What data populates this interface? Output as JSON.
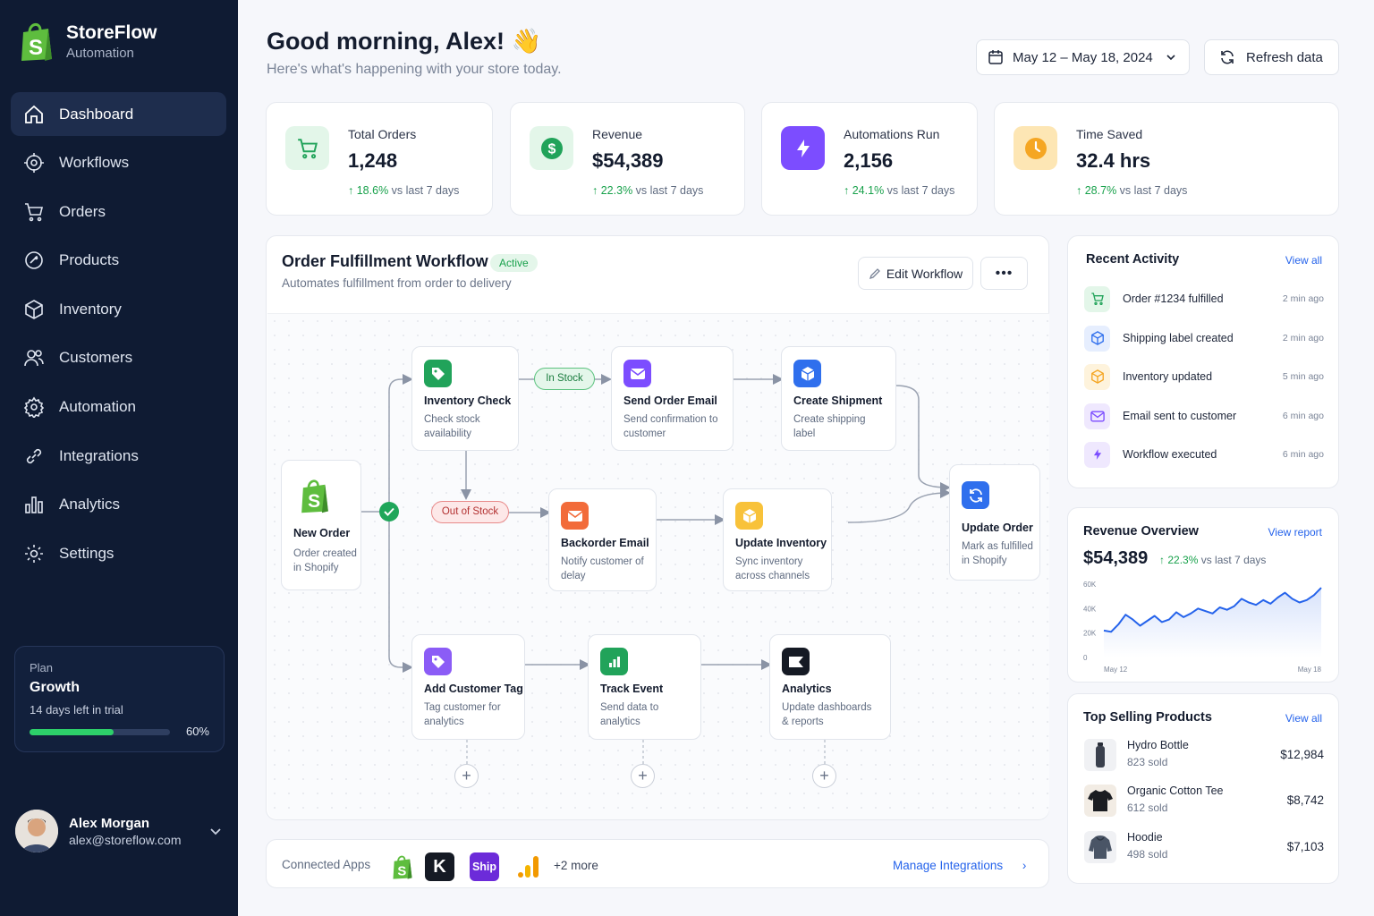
{
  "brand": {
    "name": "StoreFlow",
    "subtitle": "Automation"
  },
  "nav": [
    {
      "label": "Dashboard",
      "icon": "home-icon",
      "active": true
    },
    {
      "label": "Workflows",
      "icon": "workflow-icon"
    },
    {
      "label": "Orders",
      "icon": "cart-icon"
    },
    {
      "label": "Products",
      "icon": "tag-icon"
    },
    {
      "label": "Inventory",
      "icon": "box-icon"
    },
    {
      "label": "Customers",
      "icon": "users-icon"
    },
    {
      "label": "Automation",
      "icon": "gear-icon"
    },
    {
      "label": "Integrations",
      "icon": "link-icon"
    },
    {
      "label": "Analytics",
      "icon": "bar-chart-icon"
    },
    {
      "label": "Settings",
      "icon": "settings-icon"
    }
  ],
  "plan": {
    "label": "Plan",
    "name": "Growth",
    "trial": "14 days left in trial",
    "progress": 0.6,
    "progress_text": "60%"
  },
  "user": {
    "name": "Alex Morgan",
    "email": "alex@storeflow.com"
  },
  "header": {
    "greeting": "Good morning, Alex!",
    "greeting_emoji": "👋",
    "subtitle": "Here's what's happening with your store today.",
    "date_range": "May 12 – May 18, 2024",
    "refresh_label": "Refresh data"
  },
  "stats": [
    {
      "label": "Total Orders",
      "value": "1,248",
      "change": "18.6%",
      "period": "vs last 7 days",
      "icon": "cart-icon",
      "color": "#21a35a"
    },
    {
      "label": "Revenue",
      "value": "$54,389",
      "change": "22.3%",
      "period": "vs last 7 days",
      "icon": "dollar-icon",
      "color": "#21a35a"
    },
    {
      "label": "Automations Run",
      "value": "2,156",
      "change": "24.1%",
      "period": "vs last 7 days",
      "icon": "bolt-icon",
      "color": "#7c4dff"
    },
    {
      "label": "Time Saved",
      "value": "32.4 hrs",
      "change": "28.7%",
      "period": "vs last 7 days",
      "icon": "clock-icon",
      "color": "#f5a623"
    }
  ],
  "workflow": {
    "title": "Order Fulfillment Workflow",
    "status": "Active",
    "description": "Automates fulfillment from order to delivery",
    "edit_label": "Edit Workflow",
    "more_label": "•••",
    "nodes": {
      "new_order": {
        "title": "New Order",
        "desc": "Order created in Shopify"
      },
      "inventory_check": {
        "title": "Inventory Check",
        "desc": "Check stock availability"
      },
      "send_email": {
        "title": "Send Order Email",
        "desc": "Send confirmation to customer"
      },
      "create_shipment": {
        "title": "Create Shipment",
        "desc": "Create shipping label"
      },
      "backorder": {
        "title": "Backorder Email",
        "desc": "Notify customer of delay"
      },
      "update_inventory": {
        "title": "Update Inventory",
        "desc": "Sync inventory across channels"
      },
      "update_order": {
        "title": "Update Order",
        "desc": "Mark as fulfilled in Shopify"
      },
      "add_tag": {
        "title": "Add Customer Tag",
        "desc": "Tag customer for analytics"
      },
      "track_event": {
        "title": "Track Event",
        "desc": "Send data to analytics"
      },
      "analytics": {
        "title": "Analytics",
        "desc": "Update dashboards & reports"
      }
    },
    "in_stock_label": "In Stock",
    "out_of_stock_label": "Out of Stock",
    "add_step": "+"
  },
  "connected_apps": {
    "label": "Connected Apps",
    "apps": [
      "shopify-icon",
      "klaviyo-icon",
      "shipstation-icon",
      "analytics-icon"
    ],
    "ship_text": "Ship",
    "k_text": "K",
    "more": "+2 more",
    "manage_label": "Manage Integrations"
  },
  "recent_activity": {
    "title": "Recent Activity",
    "view_all": "View all",
    "items": [
      {
        "text": "Order #1234 fulfilled",
        "time": "2 min ago",
        "icon": "cart-icon",
        "color": "#21a35a"
      },
      {
        "text": "Shipping label created",
        "time": "2 min ago",
        "icon": "box-icon",
        "color": "#2f6fed"
      },
      {
        "text": "Inventory updated",
        "time": "5 min ago",
        "icon": "box-icon",
        "color": "#f5a623"
      },
      {
        "text": "Email sent to customer",
        "time": "6 min ago",
        "icon": "mail-icon",
        "color": "#7c4dff"
      },
      {
        "text": "Workflow executed",
        "time": "6 min ago",
        "icon": "bolt-icon",
        "color": "#7c4dff"
      }
    ]
  },
  "revenue": {
    "title": "Revenue Overview",
    "view_report": "View report",
    "value": "$54,389",
    "change": "22.3%",
    "period": "vs last 7 days"
  },
  "chart_data": {
    "type": "area",
    "x_labels": [
      "May 12",
      "May 18"
    ],
    "y_ticks": [
      "60K",
      "40K",
      "20K",
      "0"
    ],
    "ylim": [
      0,
      60000
    ],
    "values": [
      22000,
      21000,
      27000,
      35000,
      31000,
      26000,
      30000,
      34000,
      29000,
      31000,
      37000,
      33000,
      36000,
      40000,
      38000,
      36000,
      41000,
      39000,
      42000,
      48000,
      45000,
      43000,
      47000,
      44000,
      49000,
      53000,
      48000,
      45000,
      47000,
      51000,
      57000
    ],
    "color": "#2563eb"
  },
  "top_products": {
    "title": "Top Selling Products",
    "view_all": "View all",
    "items": [
      {
        "name": "Hydro Bottle",
        "sold": "823 sold",
        "revenue": "$12,984"
      },
      {
        "name": "Organic Cotton Tee",
        "sold": "612 sold",
        "revenue": "$8,742"
      },
      {
        "name": "Hoodie",
        "sold": "498 sold",
        "revenue": "$7,103"
      }
    ]
  }
}
